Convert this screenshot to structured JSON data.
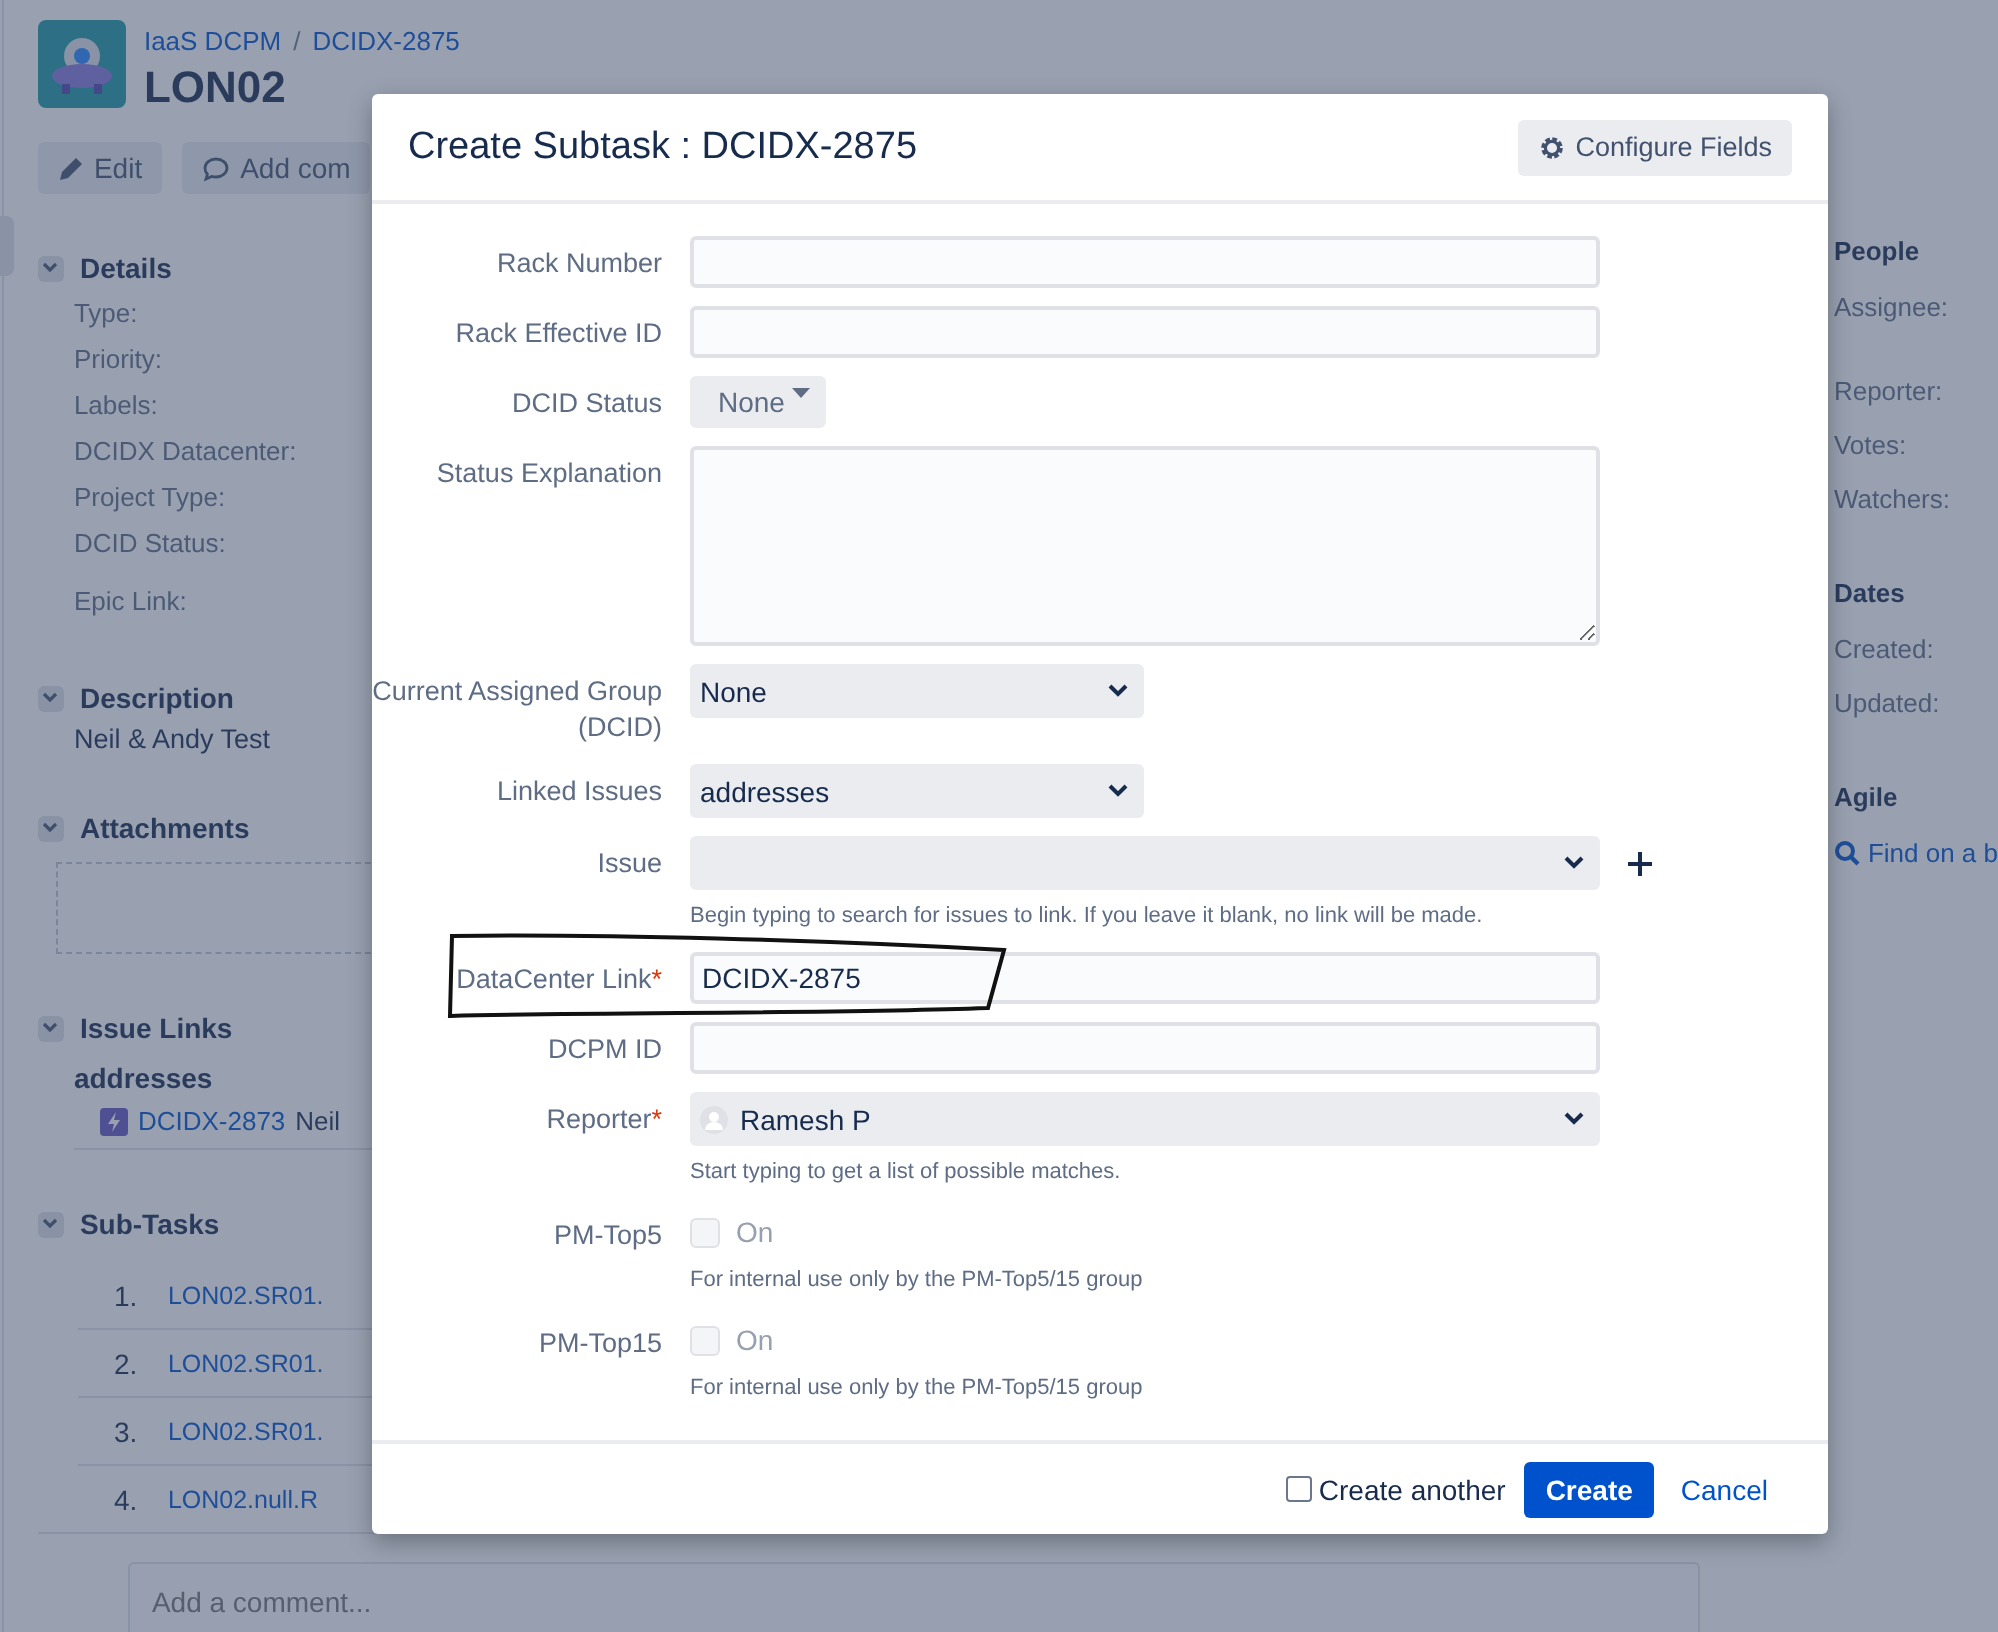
{
  "issue": {
    "breadcrumb": [
      {
        "kind": "link",
        "text": "IaaS DCPM"
      },
      {
        "kind": "separator",
        "text": "/"
      },
      {
        "kind": "link",
        "text": "DCIDX-2875"
      }
    ],
    "title": "LON02",
    "actions": [
      {
        "label": "Edit"
      },
      {
        "label": "Add com"
      }
    ],
    "sections": [
      {
        "kind": "fields",
        "heading": "Details",
        "expanded": true,
        "items": [
          "Type:",
          "Priority:",
          "Labels:",
          "DCIDX Datacenter:",
          "Project Type:",
          "DCID Status:",
          "Epic Link:"
        ]
      },
      {
        "kind": "text",
        "heading": "Description",
        "expanded": true,
        "text": "Neil & Andy Test"
      },
      {
        "kind": "dropzone",
        "heading": "Attachments",
        "expanded": true
      },
      {
        "kind": "links",
        "heading": "Issue Links",
        "expanded": true,
        "group": "addresses",
        "links": [
          {
            "key": "DCIDX-2873",
            "summary": "Neil"
          }
        ]
      },
      {
        "kind": "subtasks",
        "heading": "Sub-Tasks",
        "expanded": true,
        "rows": [
          {
            "number": "1.",
            "key": "LON02.SR01."
          },
          {
            "number": "2.",
            "key": "LON02.SR01."
          },
          {
            "number": "3.",
            "key": "LON02.SR01."
          },
          {
            "number": "4.",
            "key": "LON02.null.R"
          }
        ]
      }
    ],
    "comment": {
      "placeholder": "Add a comment..."
    },
    "side": [
      {
        "heading": "People",
        "items": [
          {
            "kind": "label",
            "text": "Assignee:"
          },
          {
            "kind": "label",
            "text": "Reporter:"
          },
          {
            "kind": "label",
            "text": "Votes:"
          },
          {
            "kind": "label",
            "text": "Watchers:"
          }
        ]
      },
      {
        "heading": "Dates",
        "items": [
          {
            "kind": "label",
            "text": "Created:"
          },
          {
            "kind": "label",
            "text": "Updated:"
          }
        ]
      },
      {
        "heading": "Agile",
        "items": [
          {
            "kind": "search-link",
            "text": "Find on a b"
          }
        ]
      }
    ]
  },
  "dialog": {
    "title": "Create Subtask : DCIDX-2875",
    "required_mark": "*",
    "configure_button": "Configure Fields",
    "fields": [
      {
        "kind": "text",
        "label": "Rack Number",
        "required": false
      },
      {
        "kind": "text",
        "label": "Rack Effective ID",
        "required": false
      },
      {
        "kind": "menu",
        "label": "DCID Status",
        "required": false,
        "value": "None"
      },
      {
        "kind": "textarea",
        "label": "Status Explanation",
        "required": false
      },
      {
        "kind": "select",
        "label": "Current Assigned Group (DCID)",
        "required": false,
        "value": "None"
      },
      {
        "kind": "select",
        "label": "Linked Issues",
        "required": false,
        "value": "addresses"
      },
      {
        "kind": "wide-select",
        "label": "Issue",
        "required": false,
        "add": true,
        "hint": "Begin typing to search for issues to link. If you leave it blank, no link will be made."
      },
      {
        "kind": "text",
        "label": "DataCenter Link",
        "required": true,
        "value": "DCIDX-2875"
      },
      {
        "kind": "text",
        "label": "DCPM ID",
        "required": false
      },
      {
        "kind": "user",
        "label": "Reporter",
        "required": true,
        "value": "Ramesh P",
        "hint": "Start typing to get a list of possible matches."
      },
      {
        "kind": "checkbox",
        "label": "PM-Top5",
        "required": false,
        "option": "On",
        "checked": false,
        "hint": "For internal use only by the PM-Top5/15 group"
      },
      {
        "kind": "checkbox",
        "label": "PM-Top15",
        "required": false,
        "option": "On",
        "checked": false,
        "hint": "For internal use only by the PM-Top5/15 group"
      }
    ],
    "create_another": {
      "label": "Create another",
      "checked": false
    },
    "submit": "Create",
    "cancel": "Cancel"
  }
}
